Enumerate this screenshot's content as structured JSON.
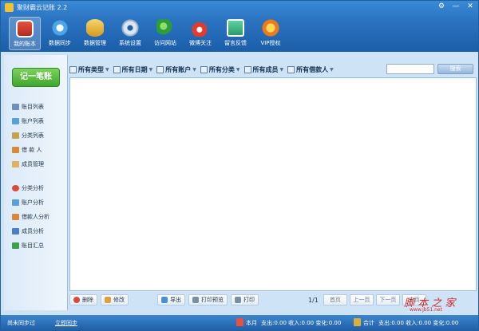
{
  "window": {
    "title": "聚财霸云记账 2.2",
    "controls": [
      "⚙",
      "—",
      "✕"
    ]
  },
  "toolbar": {
    "items": [
      {
        "label": "我的账本",
        "icon": "ledger-icon",
        "active": true
      },
      {
        "label": "数据同步",
        "icon": "sync-icon",
        "active": false
      },
      {
        "label": "数据管理",
        "icon": "database-icon",
        "active": false
      },
      {
        "label": "系统设置",
        "icon": "gear-icon",
        "active": false
      },
      {
        "label": "访问网站",
        "icon": "globe-icon",
        "active": false
      },
      {
        "label": "微博关注",
        "icon": "weibo-icon",
        "active": false
      },
      {
        "label": "留言反馈",
        "icon": "message-icon",
        "active": false
      },
      {
        "label": "VIP授权",
        "icon": "vip-icon",
        "active": false
      }
    ]
  },
  "sidebar": {
    "record_button": "记一笔账",
    "group1": [
      {
        "label": "账目列表",
        "icon": "list-icon",
        "color": "#6f8fbf"
      },
      {
        "label": "账户列表",
        "icon": "account-icon",
        "color": "#5aa0d8"
      },
      {
        "label": "分类列表",
        "icon": "category-icon",
        "color": "#c8a24a"
      },
      {
        "label": "借 款 人",
        "icon": "borrower-icon",
        "color": "#d9883a"
      },
      {
        "label": "成员管理",
        "icon": "member-icon",
        "color": "#e0b060"
      }
    ],
    "group2": [
      {
        "label": "分类分析",
        "icon": "pie-chart-icon",
        "color": "#d84b3a"
      },
      {
        "label": "账户分析",
        "icon": "account-chart-icon",
        "color": "#5aa0d8"
      },
      {
        "label": "借款人分析",
        "icon": "borrower-chart-icon",
        "color": "#d9883a"
      },
      {
        "label": "成员分析",
        "icon": "member-chart-icon",
        "color": "#4a7fc8"
      },
      {
        "label": "账目汇总",
        "icon": "summary-icon",
        "color": "#3fa04a"
      }
    ]
  },
  "filters": [
    {
      "label": "所有类型",
      "icon": "type-icon"
    },
    {
      "label": "所有日期",
      "icon": "calendar-icon"
    },
    {
      "label": "所有账户",
      "icon": "account-icon"
    },
    {
      "label": "所有分类",
      "icon": "category-icon"
    },
    {
      "label": "所有成员",
      "icon": "member-icon"
    },
    {
      "label": "所有借款人",
      "icon": "borrower-icon"
    }
  ],
  "search": {
    "placeholder": "",
    "button": "搜索"
  },
  "actions": {
    "delete": "删除",
    "edit": "修改",
    "export": "导出",
    "print_preview": "打印预览",
    "print": "打印"
  },
  "pager": {
    "page": "1/1",
    "first": "首页",
    "prev": "上一页",
    "next": "下一页",
    "last": "末页"
  },
  "status": {
    "sync_state": "尚未同步过",
    "sync_now": "立即同步",
    "month_label": "本月",
    "month_values": "支出:0.00 收入:0.00 变化:0.00",
    "total_label": "合计",
    "total_values": "支出:0.00 收入:0.00 变化:0.00"
  },
  "watermark": {
    "text": "脚 本 之 家",
    "url": "www.jb51.net"
  }
}
